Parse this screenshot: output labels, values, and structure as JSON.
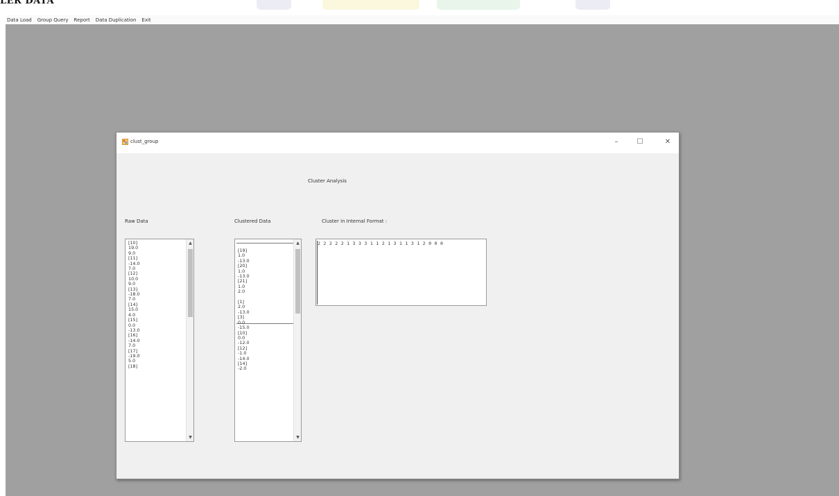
{
  "page": {
    "heading": "LER DATA"
  },
  "menu": {
    "items": [
      "Data Load",
      "Group Query",
      "Report",
      "Data Duplication",
      "Exit"
    ]
  },
  "window": {
    "title": "clust_group",
    "controls": {
      "minimize": "–",
      "maximize": "☐",
      "close": "✕"
    }
  },
  "form": {
    "heading": "Cluster Analysis",
    "raw_label": "Raw Data",
    "clustered_label": "Clustered Data",
    "internal_label": "Cluster in Internal Format :"
  },
  "raw_data": {
    "lines": [
      "[10]",
      "19.0",
      "9.0",
      "[11]",
      "-14.0",
      "7.0",
      "[12]",
      "10.0",
      "9.0",
      "[13]",
      "-18.0",
      "7.0",
      "[14]",
      "15.0",
      "4.0",
      "[15]",
      "0.0",
      "-13.0",
      "[16]",
      "-14.0",
      "7.0",
      "[17]",
      "-19.0",
      "5.0",
      "[18]"
    ]
  },
  "clustered_data": {
    "lines": [
      "[19]",
      "1.0",
      "-13.0",
      "[20]",
      "1.0",
      "-13.0",
      "[21]",
      "1.0",
      "2.0",
      "",
      "[1]",
      "2.0",
      "-13.0",
      "[3]",
      "0.0",
      "-15.0",
      "[10]",
      "0.0",
      "-12.0",
      "[12]",
      "-1.0",
      "-14.0",
      "[14]",
      "-2.0"
    ]
  },
  "internal_format": {
    "value": "2 2 2 2 2 1 3 3 3 1 1 2 1 3 1 1 3 1 2 0 0 0"
  },
  "icons": [
    "app-icon",
    "scroll-up-arrow-icon",
    "scroll-down-arrow-icon"
  ],
  "colors": {
    "mdi_background": "#a0a0a0",
    "form_background": "#f0f0f0"
  }
}
